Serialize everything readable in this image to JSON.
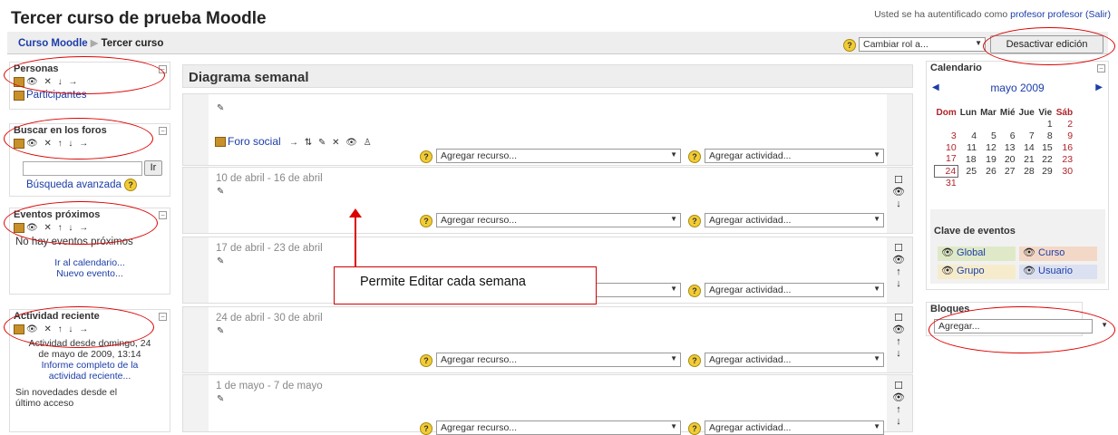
{
  "header": {
    "course_title": "Tercer curso de prueba Moodle",
    "login_prefix": "Usted se ha autentificado como ",
    "login_user": "profesor profesor",
    "logout": "(Salir)",
    "breadcrumb_home": "Curso Moodle",
    "breadcrumb_sep": "▶",
    "breadcrumb_current": "Tercer curso",
    "role_switch": "Cambiar rol a...",
    "edit_button": "Desactivar edición"
  },
  "left_blocks": {
    "people": {
      "title": "Personas",
      "participants": "Participantes"
    },
    "forum_search": {
      "title": "Buscar en los foros",
      "go": "Ir",
      "advanced": "Búsqueda avanzada"
    },
    "events": {
      "title": "Eventos próximos",
      "none": "No hay eventos próximos",
      "calendar_link": "Ir al calendario...",
      "new_event": "Nuevo evento..."
    },
    "recent": {
      "title": "Actividad reciente",
      "since_1": "Actividad desde domingo, 24",
      "since_2": "de mayo de 2009, 13:14",
      "full_report_1": "Informe completo de la",
      "full_report_2": "actividad reciente...",
      "no_news_1": "Sin novedades desde el",
      "no_news_2": "último acceso"
    }
  },
  "main": {
    "title": "Diagrama semanal",
    "forum": "Foro social",
    "add_resource": "Agregar recurso...",
    "add_activity": "Agregar actividad...",
    "weeks": [
      {
        "date": "10 de abril - 16 de abril"
      },
      {
        "date": "17 de abril - 23 de abril"
      },
      {
        "date": "24 de abril - 30 de abril"
      },
      {
        "date": "1 de mayo - 7 de mayo"
      }
    ],
    "annotation": "Permite Editar cada semana"
  },
  "calendar": {
    "title": "Calendario",
    "month": "mayo 2009",
    "day_headers": [
      "Dom",
      "Lun",
      "Mar",
      "Mié",
      "Jue",
      "Vie",
      "Sáb"
    ],
    "rows": [
      [
        "",
        "",
        "",
        "",
        "",
        "1",
        "2"
      ],
      [
        "3",
        "4",
        "5",
        "6",
        "7",
        "8",
        "9"
      ],
      [
        "10",
        "11",
        "12",
        "13",
        "14",
        "15",
        "16"
      ],
      [
        "17",
        "18",
        "19",
        "20",
        "21",
        "22",
        "23"
      ],
      [
        "24",
        "25",
        "26",
        "27",
        "28",
        "29",
        "30"
      ],
      [
        "31",
        "",
        "",
        "",
        "",
        "",
        ""
      ]
    ],
    "legend_title": "Clave de eventos",
    "legend": {
      "global": "Global",
      "course": "Curso",
      "group": "Grupo",
      "user": "Usuario"
    }
  },
  "blocks": {
    "title": "Bloques",
    "add": "Agregar..."
  },
  "colors": {
    "link": "#1b3da8",
    "annotation_red": "#dd0000",
    "weekend": "#b0222a"
  }
}
